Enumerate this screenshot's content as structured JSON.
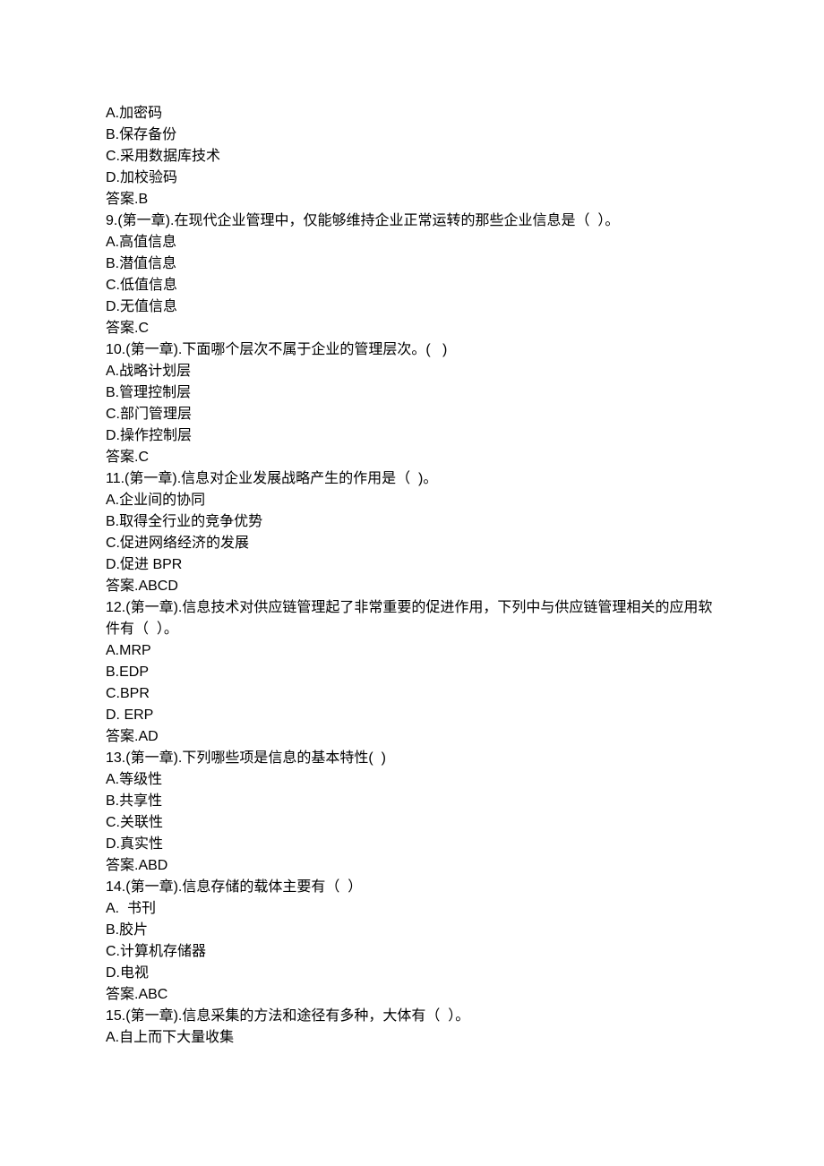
{
  "lines": [
    "A.加密码",
    "B.保存备份",
    "C.采用数据库技术",
    "D.加校验码",
    "答案.B",
    "9.(第一章).在现代企业管理中，仅能够维持企业正常运转的那些企业信息是（  ）。",
    "A.高值信息",
    "B.潜值信息",
    "C.低值信息",
    "D.无值信息",
    "答案.C",
    "10.(第一章).下面哪个层次不属于企业的管理层次。(   )",
    "A.战略计划层",
    "B.管理控制层",
    "C.部门管理层",
    "D.操作控制层",
    "答案.C",
    "11.(第一章).信息对企业发展战略产生的作用是（  )。",
    "A.企业间的协同",
    "B.取得全行业的竞争优势",
    "C.促进网络经济的发展",
    "D.促进 BPR",
    "答案.ABCD",
    "12.(第一章).信息技术对供应链管理起了非常重要的促进作用，下列中与供应链管理相关的应用软件有（  ）。",
    "A.MRP",
    "B.EDP",
    "C.BPR",
    "D. ERP",
    "答案.AD",
    "13.(第一章).下列哪些项是信息的基本特性(  )",
    "A.等级性",
    "B.共享性",
    "C.关联性",
    "D.真实性",
    "答案.ABD",
    "14.(第一章).信息存储的载体主要有（  ）",
    "A.  书刊",
    "B.胶片",
    "C.计算机存储器",
    "D.电视",
    "答案.ABC",
    "15.(第一章).信息采集的方法和途径有多种，大体有（  ）。",
    "A.自上而下大量收集"
  ]
}
